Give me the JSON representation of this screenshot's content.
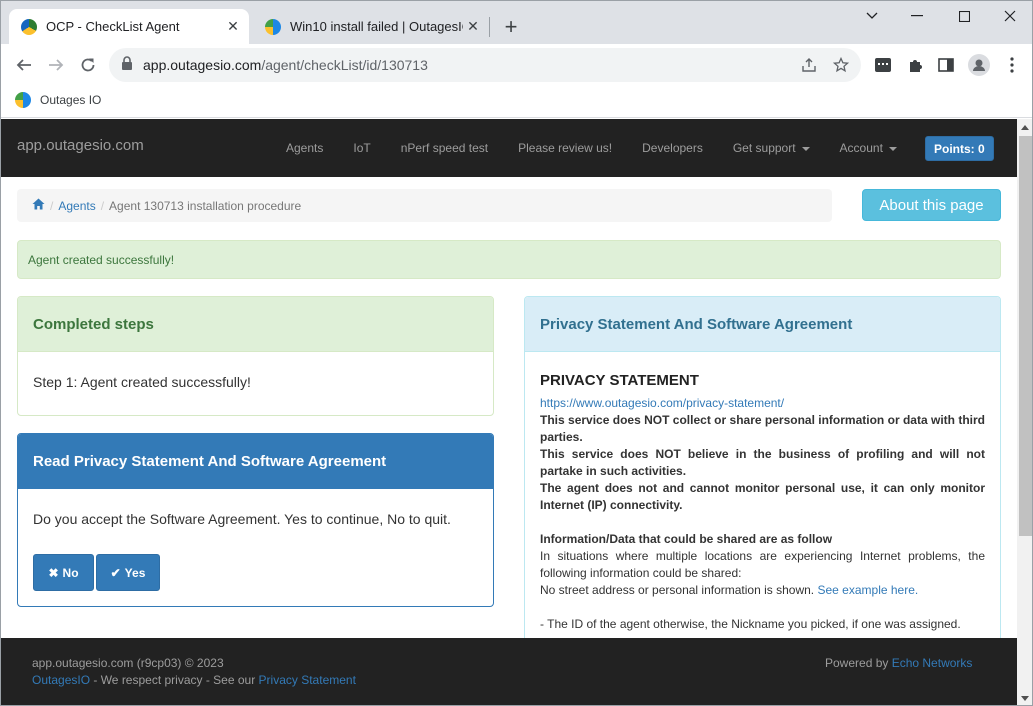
{
  "browser": {
    "tabs": [
      {
        "title": "OCP - CheckList Agent",
        "active": true
      },
      {
        "title": "Win10 install failed | OutagesIO",
        "active": false
      }
    ],
    "url_host": "app.outagesio.com",
    "url_path": "/agent/checkList/id/130713",
    "bookmark_label": "Outages IO"
  },
  "navbar": {
    "brand": "app.outagesio.com",
    "links": [
      "Agents",
      "IoT",
      "nPerf speed test",
      "Please review us!",
      "Developers"
    ],
    "dropdowns": [
      "Get support",
      "Account"
    ],
    "points": "Points: 0"
  },
  "breadcrumb": {
    "agents": "Agents",
    "current": "Agent 130713 installation procedure"
  },
  "about_button": "About this page",
  "alert": "Agent created successfully!",
  "completed": {
    "title": "Completed steps",
    "step": "Step 1: Agent created successfully!"
  },
  "agreement": {
    "title": "Read Privacy Statement And Software Agreement",
    "question": "Do you accept the Software Agreement. Yes to continue, No to quit.",
    "no": "No",
    "yes": "Yes"
  },
  "privacy": {
    "panel_title": "Privacy Statement And Software Agreement",
    "heading": "PRIVACY STATEMENT",
    "link": "https://www.outagesio.com/privacy-statement/",
    "p1": "This service does NOT collect or share personal information or data with third parties.",
    "p2": "This service does NOT believe in the business of profiling and will not partake in such activities.",
    "p3": "The agent does not and cannot monitor personal use, it can only monitor Internet (IP) connectivity.",
    "sub": "Information/Data that could be shared are as follow",
    "p4": "In situations where multiple locations are experiencing Internet problems, the following information could be shared:",
    "p5": "No street address or personal information is shown.",
    "p5_link": "See example here.",
    "p6": "- The ID of the agent otherwise, the Nickname you picked, if one was assigned."
  },
  "footer": {
    "line1": "app.outagesio.com (r9cp03) © 2023",
    "brand_link": "OutagesIO",
    "line2_mid": " - We respect privacy - See our ",
    "privacy_link": "Privacy Statement",
    "powered": "Powered by ",
    "powered_link": "Echo Networks"
  }
}
